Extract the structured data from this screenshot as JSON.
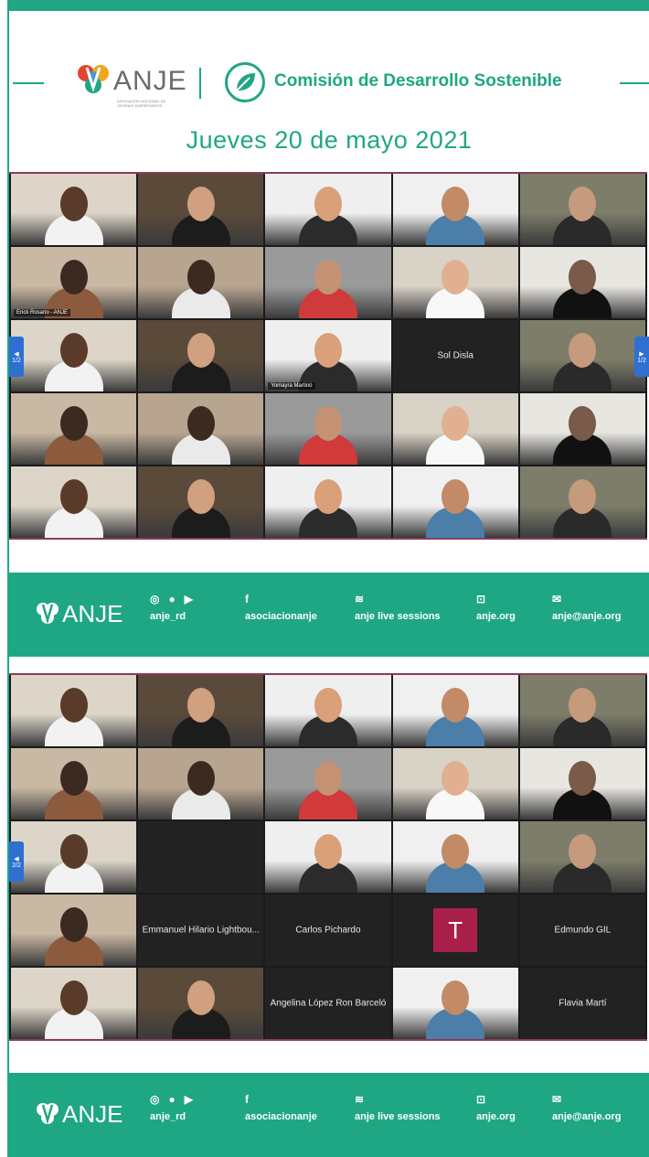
{
  "header": {
    "brand": "ANJE",
    "brand_tagline": "ASOCIACIÓN NACIONAL DE JÓVENES EMPRESARIOS",
    "commission": "Comisión de Desarrollo Sostenible",
    "date": "Jueves 20 de mayo 2021"
  },
  "colors": {
    "accent": "#1fa783",
    "border": "#8a3b5a",
    "tile_bg": "#222222",
    "avatar": "#a8204a",
    "pager": "#2e6fd0"
  },
  "grid1": {
    "pager_left": "1/2",
    "pager_right": "1/2",
    "tiles": [
      {
        "type": "video"
      },
      {
        "type": "video"
      },
      {
        "type": "video"
      },
      {
        "type": "video"
      },
      {
        "type": "video"
      },
      {
        "type": "video",
        "name": "Erick Rosario - ANJE",
        "active": true
      },
      {
        "type": "video"
      },
      {
        "type": "video"
      },
      {
        "type": "video"
      },
      {
        "type": "video"
      },
      {
        "type": "video"
      },
      {
        "type": "video"
      },
      {
        "type": "video",
        "name": "Yomayra Martinó"
      },
      {
        "type": "text",
        "label": "Sol Disla"
      },
      {
        "type": "video"
      },
      {
        "type": "video"
      },
      {
        "type": "video"
      },
      {
        "type": "video"
      },
      {
        "type": "video"
      },
      {
        "type": "video"
      },
      {
        "type": "video"
      },
      {
        "type": "video"
      },
      {
        "type": "video"
      },
      {
        "type": "video"
      },
      {
        "type": "video"
      }
    ]
  },
  "grid2": {
    "pager_left": "2/2",
    "tiles": [
      {
        "type": "video"
      },
      {
        "type": "video"
      },
      {
        "type": "video"
      },
      {
        "type": "video"
      },
      {
        "type": "video"
      },
      {
        "type": "video"
      },
      {
        "type": "video"
      },
      {
        "type": "video"
      },
      {
        "type": "video"
      },
      {
        "type": "video"
      },
      {
        "type": "video"
      },
      {
        "type": "empty"
      },
      {
        "type": "video"
      },
      {
        "type": "video"
      },
      {
        "type": "video"
      },
      {
        "type": "video"
      },
      {
        "type": "text",
        "label": "Emmanuel Hilario Lightbou..."
      },
      {
        "type": "text",
        "label": "Carlos Pichardo"
      },
      {
        "type": "avatar",
        "letter": "T"
      },
      {
        "type": "text",
        "label": "Edmundo GIL"
      },
      {
        "type": "video"
      },
      {
        "type": "video"
      },
      {
        "type": "text",
        "label": "Angelina López Ron Barceló"
      },
      {
        "type": "video"
      },
      {
        "type": "text",
        "label": "Flavia Martí"
      }
    ]
  },
  "footer": {
    "brand": "ANJE",
    "items": [
      {
        "icons": [
          "instagram-icon",
          "twitter-icon",
          "youtube-icon"
        ],
        "glyphs": [
          "◎",
          "●",
          "▶"
        ],
        "label": "anje_rd"
      },
      {
        "icons": [
          "facebook-icon"
        ],
        "glyphs": [
          "f"
        ],
        "label": "asociacionanje"
      },
      {
        "icons": [
          "spotify-icon"
        ],
        "glyphs": [
          "≋"
        ],
        "label": "anje live sessions"
      },
      {
        "icons": [
          "web-icon"
        ],
        "glyphs": [
          "⊡"
        ],
        "label": "anje.org"
      },
      {
        "icons": [
          "email-icon"
        ],
        "glyphs": [
          "✉"
        ],
        "label": "anje@anje.org"
      }
    ]
  }
}
